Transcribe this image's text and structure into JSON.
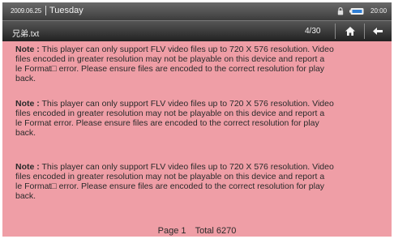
{
  "status_bar": {
    "date": "2009.06.25",
    "day": "Tuesday",
    "time": "20:00",
    "lock_icon": "lock-icon",
    "battery_icon": "battery-icon"
  },
  "title_bar": {
    "file_name": "兄弟.txt",
    "page_indicator": "4/30",
    "home_icon": "home-icon",
    "back_icon": "back-arrow-icon"
  },
  "notes": [
    {
      "label": "Note :",
      "lines": [
        "This player can only support FLV video files up to 720 X 576 resolution. Video",
        "files encoded in greater resolution may not be playable on this device and report a",
        "le Format□ error. Please ensure  files are encoded to the correct resolution for play",
        "back."
      ]
    },
    {
      "label": "Note :",
      "lines": [
        "This player can only support FLV video files up to 720 X 576 resolution. Video",
        "files encoded in greater resolution may not be playable on this device and report a",
        "le Format error. Please ensure  files are encoded to the correct resolution for play",
        "back."
      ]
    },
    {
      "label": "Note :",
      "lines": [
        "This player can only support FLV video files up to 720 X 576 resolution. Video",
        "files encoded in greater resolution may not be playable on this device and report a",
        "le Format□ error. Please ensure  files are encoded to the correct resolution for play",
        "back."
      ]
    }
  ],
  "footer": {
    "page": "Page 1",
    "total": "Total 6270"
  },
  "colors": {
    "content_background": "#ef9ea6",
    "bar_dark": "#2a2a2a",
    "text": "#2a2a2a"
  }
}
